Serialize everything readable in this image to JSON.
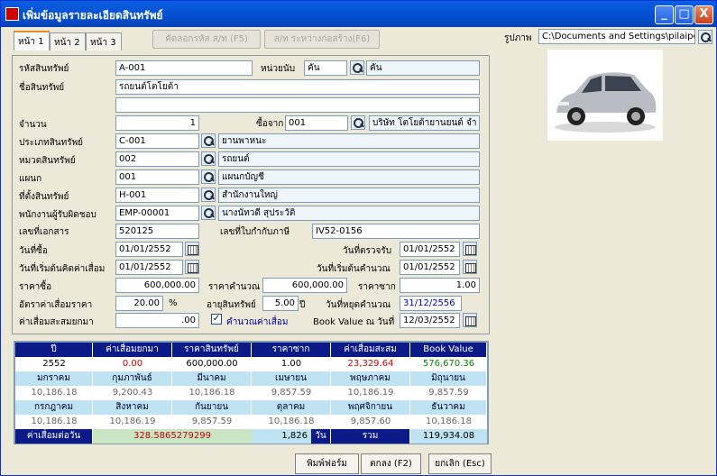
{
  "window": {
    "title": "เพิ่มข้อมูลรายละเอียดสินทรัพย์",
    "min": "_",
    "max": "□",
    "close": "X"
  },
  "tabs": [
    "หน้า 1",
    "หน้า 2",
    "หน้า 3"
  ],
  "toolbar": {
    "copy_label": "คัดลอกรหัส ส/ท (F5)",
    "build_label": "ส/ท ระหว่างก่อสร้าง(F6)"
  },
  "image": {
    "label": "รูปภาพ",
    "path": "C:\\Documents and Settings\\pilaipo"
  },
  "form": {
    "asset_code_label": "รหัสสินทรัพย์",
    "asset_code": "A-001",
    "unit_label": "หน่วยนับ",
    "unit_code": "คัน",
    "unit_name": "คัน",
    "name_label": "ชื่อสินทรัพย์",
    "name": "รถยนต์โตโยต้า",
    "name2": "",
    "qty_label": "จำนวน",
    "qty": "1",
    "buy_from_label": "ซื้อจาก",
    "vendor_code": "001",
    "vendor_name": "บริษัท โตโยต้ายานยนต์ จำ",
    "type_label": "ประเภทสินทรัพย์",
    "type_code": "C-001",
    "type_name": "ยานพาหนะ",
    "cat_label": "หมวดสินทรัพย์",
    "cat_code": "002",
    "cat_name": "รถยนต์",
    "dept_label": "แผนก",
    "dept_code": "001",
    "dept_name": "แผนกบัญชี",
    "loc_label": "ที่ตั้งสินทรัพย์",
    "loc_code": "H-001",
    "loc_name": "สำนักงานใหญ่",
    "emp_label": "พนักงานผู้รับผิดชอบ",
    "emp_code": "EMP-00001",
    "emp_name": "นางนัทวดี สุประวัติ",
    "doc_label": "เลขที่เอกสาร",
    "doc": "520125",
    "tax_label": "เลขที่ใบกำกับภาษี",
    "tax": "IV52-0156",
    "buy_date_label": "วันที่ซื้อ",
    "buy_date": "01/01/2552",
    "check_date_label": "วันที่ตรวจรับ",
    "check_date": "01/01/2552",
    "dep_start_label": "วันที่เริ่มต้นคิดค่าเสื่อม",
    "dep_start": "01/01/2552",
    "calc_start_label": "วันที่เริ่มต้นคำนวณ",
    "calc_start": "01/01/2552",
    "price_label": "ราคาซื้อ",
    "price": "600,000.00",
    "calc_price_label": "ราคาคำนวณ",
    "calc_price": "600,000.00",
    "salvage_label": "ราคาซาก",
    "salvage": "1.00",
    "rate_label": "อัตราค่าเสื่อมราคา",
    "rate": "20.00",
    "pct": "%",
    "life_label": "อายุสินทรัพย์",
    "life": "5.00",
    "year_unit": "ปี",
    "stop_label": "วันที่หยุดคำนวณ",
    "stop_date": "31/12/2556",
    "acc_label": "ค่าเสื่อมสะสมยกมา",
    "acc": ".00",
    "calc_dep_check": "✓",
    "calc_dep_label": "คำนวณค่าเสื่อม",
    "bv_date_label": "Book Value ณ วันที่",
    "bv_date": "12/03/2552"
  },
  "summary": {
    "headers": [
      "ปี",
      "ค่าเสื่อมยกมา",
      "ราคาสินทรัพย์",
      "ราคาซาก",
      "ค่าเสื่อมสะสม",
      "Book Value"
    ],
    "row": [
      "2552",
      "0.00",
      "600,000.00",
      "1.00",
      "23,329.64",
      "576,670.36"
    ],
    "months1": [
      "มกราคม",
      "กุมภาพันธ์",
      "มีนาคม",
      "เมษายน",
      "พฤษภาคม",
      "มิถุนายน"
    ],
    "vals1": [
      "10,186.18",
      "9,200.43",
      "10,186.18",
      "9,857.59",
      "10,186.19",
      "9,857.59"
    ],
    "months2": [
      "กรกฎาคม",
      "สิงหาคม",
      "กันยายน",
      "ตุลาคม",
      "พฤศจิกายน",
      "ธันวาคม"
    ],
    "vals2": [
      "10,186.18",
      "10,186.19",
      "9,857.59",
      "10,186.18",
      "9,857.60",
      "10,186.18"
    ],
    "perday_label": "ค่าเสื่อมต่อวัน",
    "perday": "328.5865279299",
    "days": "1,826",
    "days_unit": "วัน",
    "total_label": "รวม",
    "total": "119,934.08"
  },
  "buttons": {
    "print": "พิมพ์ฟอร์ม",
    "ok": "ตกลง (F2)",
    "cancel": "ยกเลิก (Esc)"
  }
}
